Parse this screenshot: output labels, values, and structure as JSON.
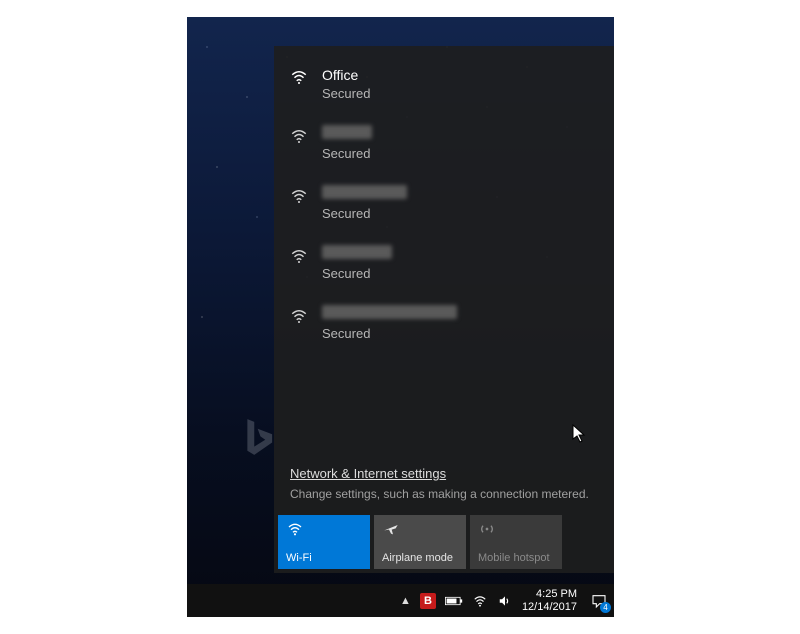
{
  "networks": [
    {
      "name": "Office",
      "status": "Secured",
      "redacted": false
    },
    {
      "name": "",
      "status": "Secured",
      "redacted": true,
      "redactWidth": 50
    },
    {
      "name": "",
      "status": "Secured",
      "redacted": true,
      "redactWidth": 85
    },
    {
      "name": "",
      "status": "Secured",
      "redacted": true,
      "redactWidth": 70
    },
    {
      "name": "",
      "status": "Secured",
      "redacted": true,
      "redactWidth": 135
    }
  ],
  "settings": {
    "link": "Network & Internet settings",
    "desc": "Change settings, such as making a connection metered."
  },
  "tiles": {
    "wifi": "Wi-Fi",
    "airplane": "Airplane mode",
    "hotspot": "Mobile hotspot"
  },
  "clock": {
    "time": "4:25 PM",
    "date": "12/14/2017"
  },
  "action_center_count": "4",
  "tray_badge_letter": "B"
}
